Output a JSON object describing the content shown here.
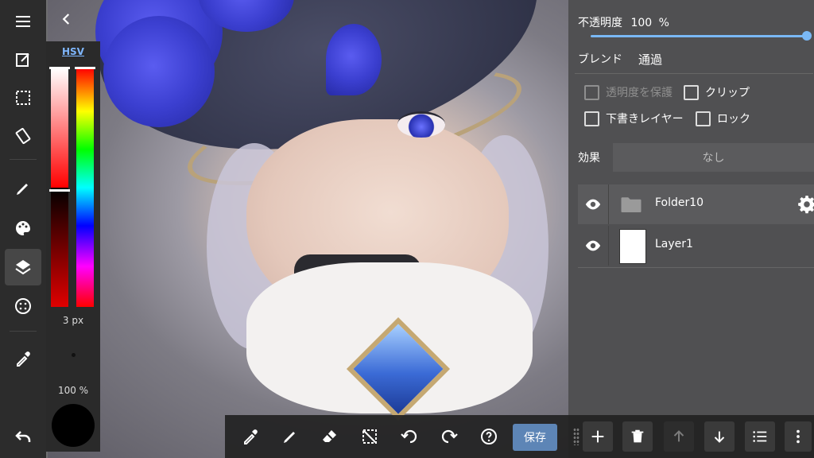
{
  "color_panel": {
    "mode_label": "HSV",
    "brush_size": "3 px",
    "brush_opacity": "100 %",
    "current_color": "#000000"
  },
  "layer_panel": {
    "opacity_label": "不透明度",
    "opacity_value": "100",
    "opacity_unit": "%",
    "opacity_fraction": 1.0,
    "blend_label": "ブレンド",
    "blend_value": "通過",
    "options": {
      "protect_alpha": "透明度を保護",
      "clip": "クリップ",
      "draft": "下書きレイヤー",
      "lock": "ロック"
    },
    "effect_label": "効果",
    "effect_value": "なし",
    "layers": [
      {
        "name": "Folder10",
        "type": "folder",
        "selected": true
      },
      {
        "name": "Layer1",
        "type": "layer",
        "selected": false
      }
    ]
  },
  "bottom_toolbar": {
    "save_label": "保存"
  },
  "colors": {
    "accent": "#7ab8f5",
    "save_button": "#5d85b6",
    "toolbar_bg": "#2c2c2c"
  }
}
